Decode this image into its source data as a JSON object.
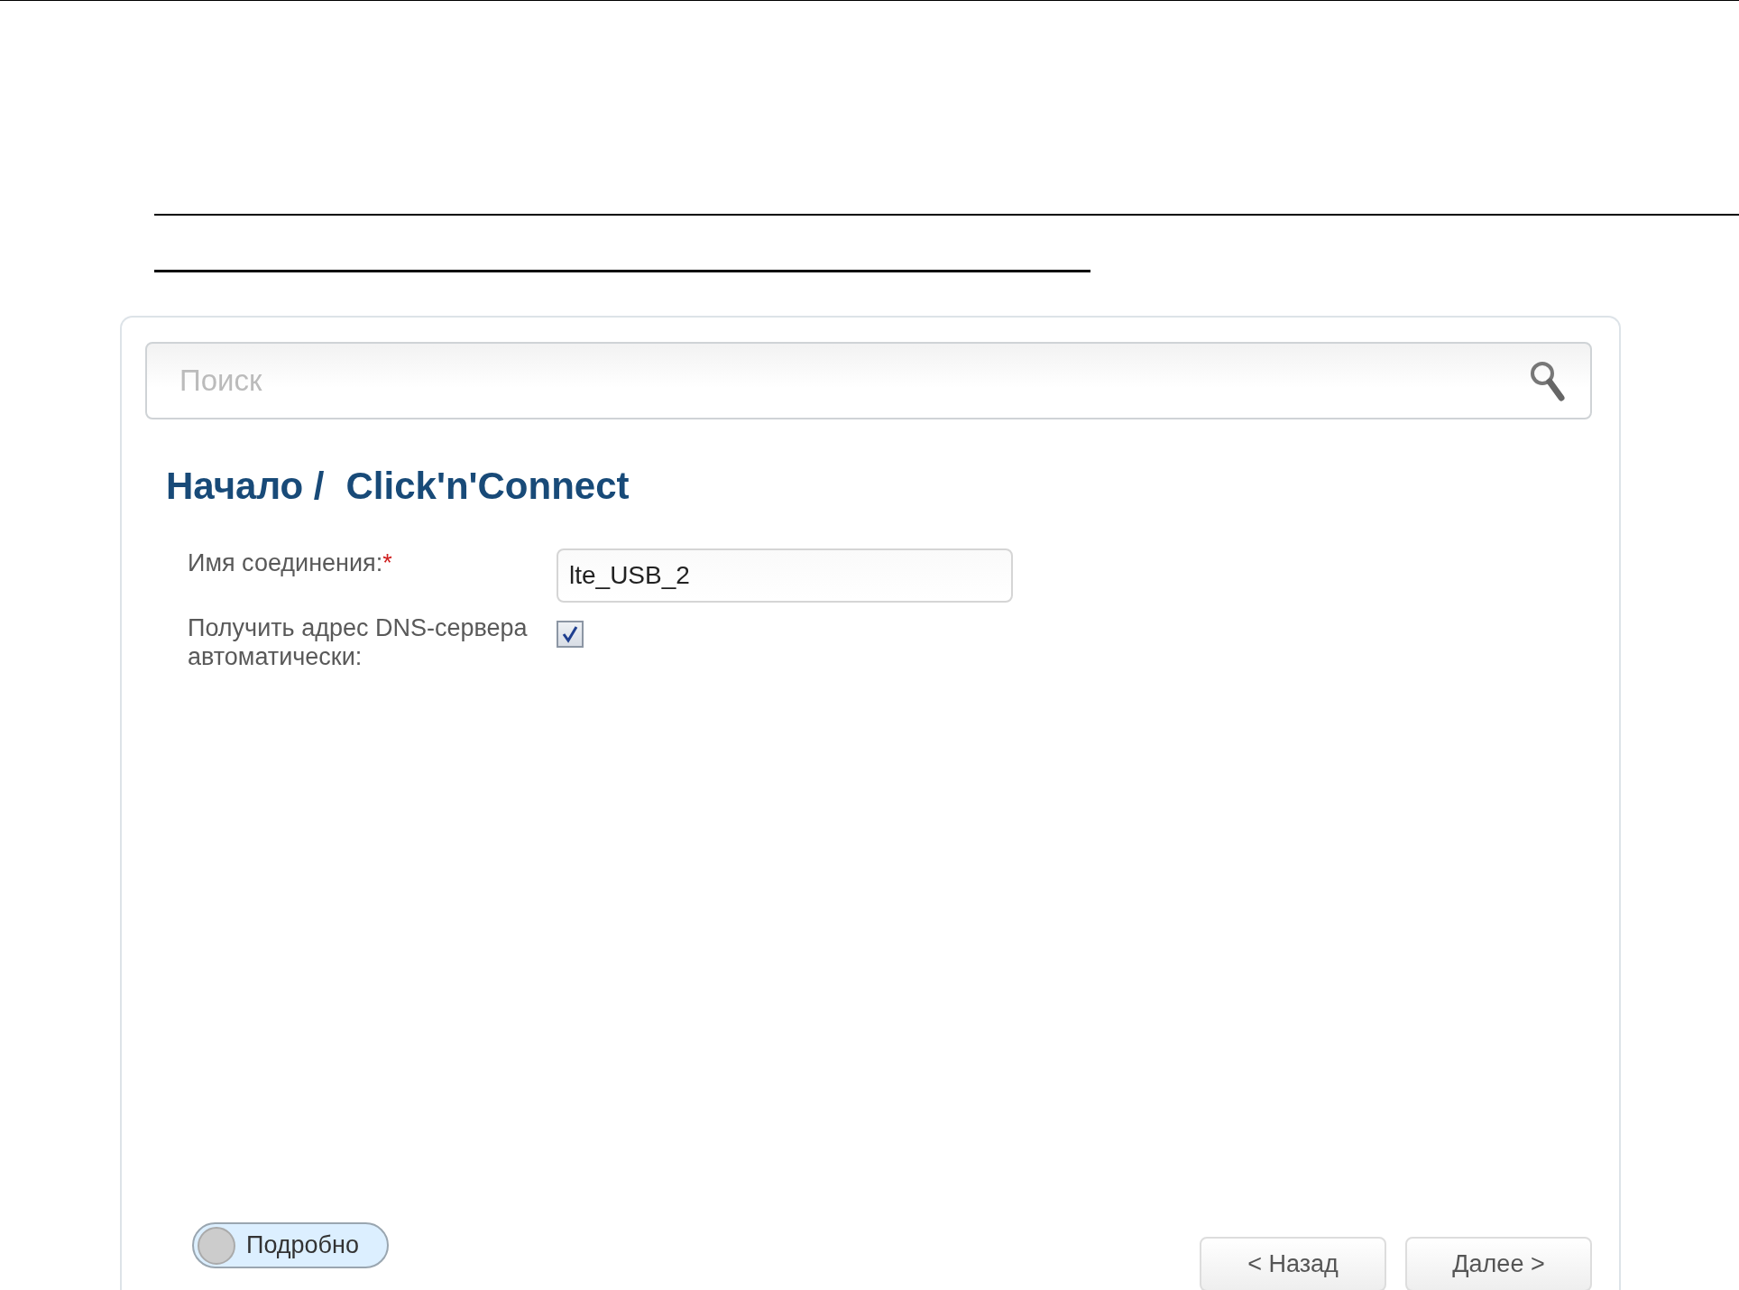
{
  "search": {
    "placeholder": "Поиск"
  },
  "breadcrumb": [
    "Начало /",
    "Click'n'Connect"
  ],
  "form": [
    {
      "kind": "text",
      "label": "Имя соединения:",
      "required_mark": "*",
      "value": "lte_USB_2"
    },
    {
      "kind": "checkbox",
      "label": "Получить адрес DNS-сервера автоматически:",
      "checked": true
    }
  ],
  "details_toggle": {
    "label": "Подробно",
    "on": false
  },
  "buttons": [
    "< Назад",
    "Далее >"
  ]
}
